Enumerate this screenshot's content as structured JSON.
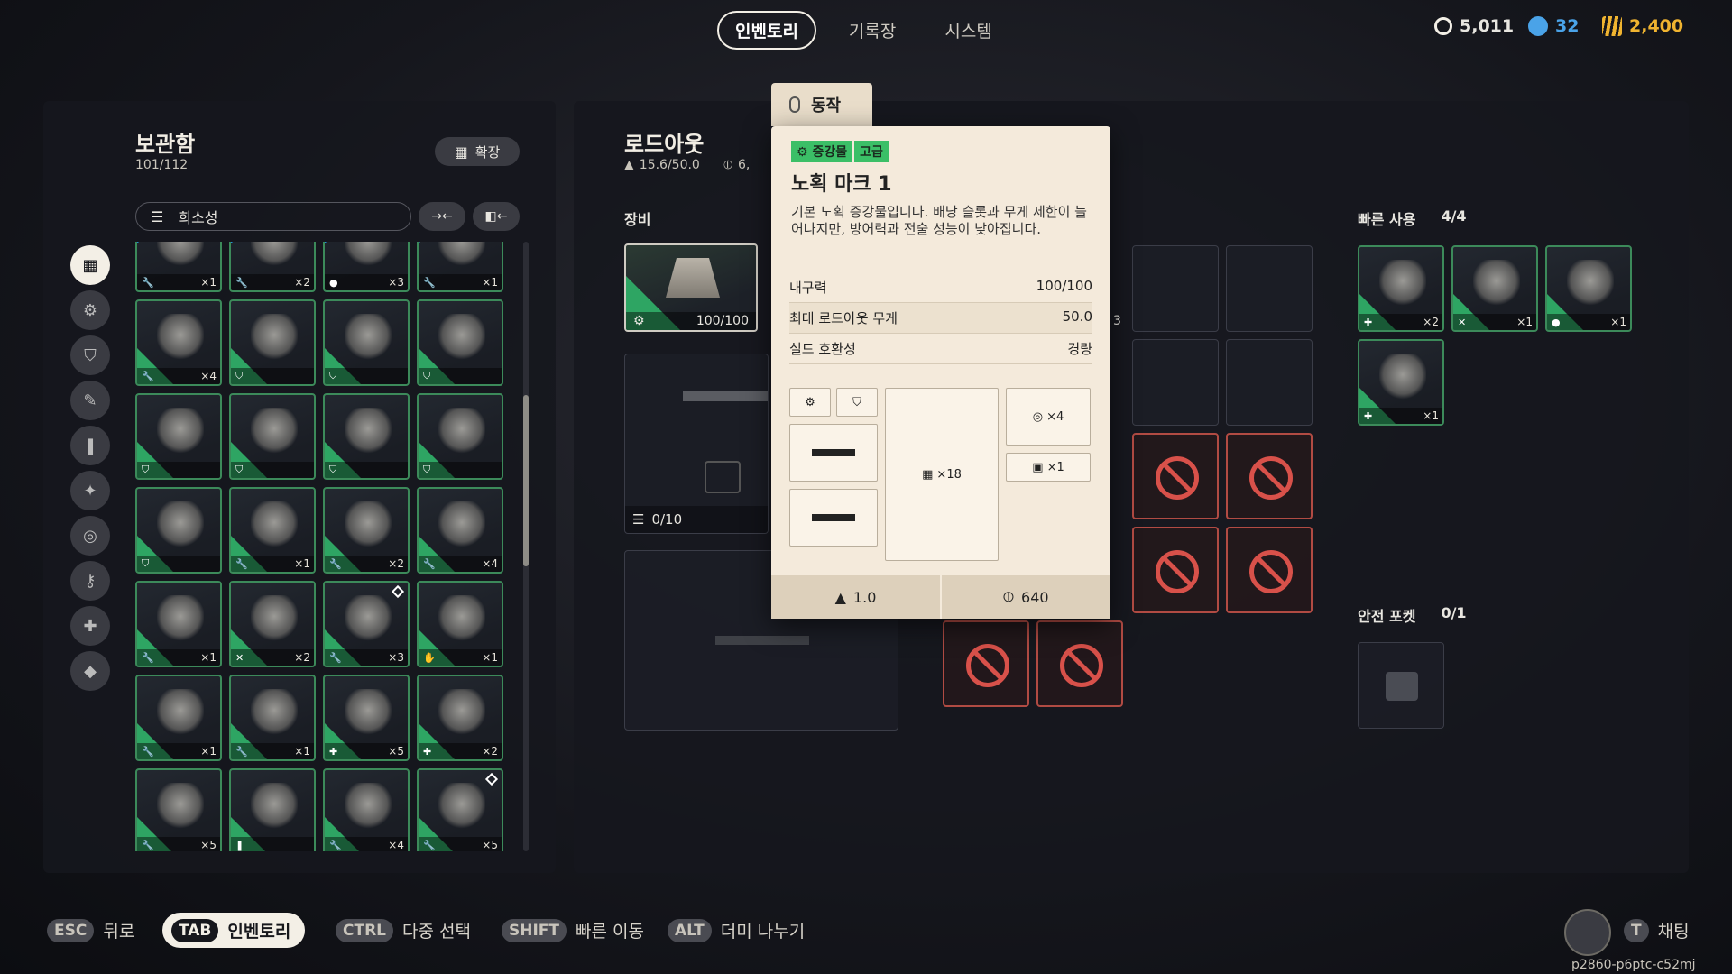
{
  "top_tabs": [
    "인벤토리",
    "기록장",
    "시스템"
  ],
  "currencies": [
    {
      "icon": "coin-icon",
      "value": "5,011",
      "color": "#f3efe6"
    },
    {
      "icon": "token-icon",
      "value": "32",
      "color": "#4aa3e8"
    },
    {
      "icon": "raider-token-icon",
      "value": "2,400",
      "color": "#f0b430"
    }
  ],
  "storage": {
    "title": "보관함",
    "capacity": "101/112",
    "expand_label": "확장",
    "filter_label": "희소성",
    "categories": [
      "all-items-icon",
      "augment-icon",
      "shield-icon",
      "weapon-icon",
      "ammo-icon",
      "mods-icon",
      "quick-use-icon",
      "key-icon",
      "material-icon",
      "misc-icon"
    ],
    "rows": [
      [
        {
          "q": "×1",
          "t": "wrench",
          "b": true
        },
        {
          "q": "×2",
          "t": "wrench",
          "b": true
        },
        {
          "q": "×3",
          "t": "grenade",
          "b": true
        },
        {
          "q": "×1",
          "t": "wrench",
          "b": true
        }
      ],
      [
        {
          "q": "×4",
          "t": "wrench"
        },
        {
          "q": "",
          "t": "shield"
        },
        {
          "q": "",
          "t": "shield"
        },
        {
          "q": "",
          "t": "shield"
        }
      ],
      [
        {
          "q": "",
          "t": "shield"
        },
        {
          "q": "",
          "t": "shield"
        },
        {
          "q": "",
          "t": "shield"
        },
        {
          "q": "",
          "t": "shield"
        }
      ],
      [
        {
          "q": "",
          "t": "shield"
        },
        {
          "q": "×1",
          "t": "wrench"
        },
        {
          "q": "×2",
          "t": "wrench"
        },
        {
          "q": "×4",
          "t": "wrench"
        }
      ],
      [
        {
          "q": "×1",
          "t": "wrench"
        },
        {
          "q": "×2",
          "t": "cross"
        },
        {
          "q": "×3",
          "t": "wrench",
          "d": true
        },
        {
          "q": "×1",
          "t": "hand"
        }
      ],
      [
        {
          "q": "×1",
          "t": "wrench"
        },
        {
          "q": "×1",
          "t": "wrench"
        },
        {
          "q": "×5",
          "t": "plus"
        },
        {
          "q": "×2",
          "t": "plus"
        }
      ],
      [
        {
          "q": "×5",
          "t": "wrench"
        },
        {
          "q": "",
          "t": "ammo"
        },
        {
          "q": "×4",
          "t": "wrench"
        },
        {
          "q": "×5",
          "t": "wrench",
          "d": true
        }
      ]
    ]
  },
  "loadout": {
    "title": "로드아웃",
    "weight": "15.6/50.0",
    "coins_partial": "6,",
    "equipment_label": "장비",
    "augment_durability": "100/100",
    "backpack_count": "0/10",
    "slot_partial": "3"
  },
  "quick_use": {
    "title": "빠른 사용",
    "count": "4/4",
    "items": [
      {
        "q": "×2",
        "t": "plus"
      },
      {
        "q": "×1",
        "t": "cross"
      },
      {
        "q": "×1",
        "t": "grenade"
      },
      {
        "q": "×1",
        "t": "plus"
      }
    ]
  },
  "safe_pocket": {
    "title": "안전 포켓",
    "count": "0/1"
  },
  "tooltip": {
    "tab_label": "동작",
    "badges": [
      "증강물",
      "고급"
    ],
    "name": "노획 마크 1",
    "description": "기본 노획 증강물입니다. 배낭 슬롯과 무게 제한이 늘어나지만, 방어력과 전술 성능이 낮아집니다.",
    "stats": [
      {
        "label": "내구력",
        "value": "100/100"
      },
      {
        "label": "최대 로드아웃 무게",
        "value": "50.0"
      },
      {
        "label": "실드 호환성",
        "value": "경량"
      }
    ],
    "grid_slots": "×18",
    "ammo_slots": "×4",
    "safe_slots": "×1",
    "weight": "1.0",
    "price": "640"
  },
  "bottom_hints": [
    {
      "key": "ESC",
      "label": "뒤로"
    },
    {
      "key": "TAB",
      "label": "인벤토리",
      "active": true
    },
    {
      "key": "CTRL",
      "label": "다중 선택"
    },
    {
      "key": "SHIFT",
      "label": "빠른 이동"
    },
    {
      "key": "ALT",
      "label": "더미 나누기"
    }
  ],
  "chat": {
    "key": "T",
    "label": "채팅"
  },
  "watermark": "p2860-p6ptc-c52mj"
}
